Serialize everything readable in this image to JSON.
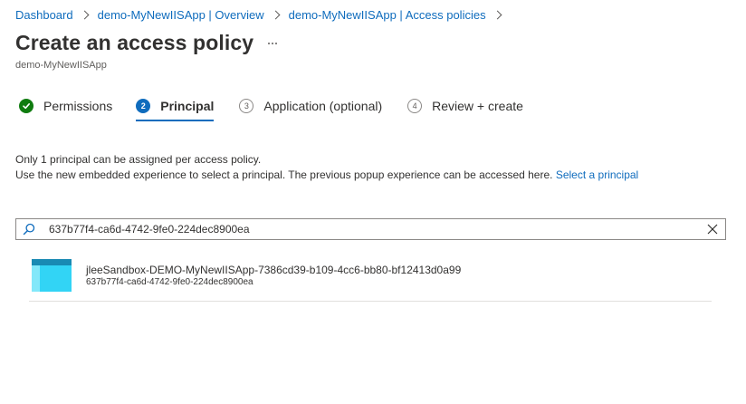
{
  "breadcrumb": {
    "items": [
      {
        "label": "Dashboard"
      },
      {
        "label": "demo-MyNewIISApp | Overview"
      },
      {
        "label": "demo-MyNewIISApp | Access policies"
      }
    ]
  },
  "header": {
    "title": "Create an access policy",
    "subtitle": "demo-MyNewIISApp",
    "more_icon": "ellipsis-icon"
  },
  "steps": [
    {
      "number": "",
      "label": "Permissions",
      "state": "completed",
      "icon": "checkmark-circle-icon"
    },
    {
      "number": "2",
      "label": "Principal",
      "state": "active"
    },
    {
      "number": "3",
      "label": "Application (optional)",
      "state": "pending"
    },
    {
      "number": "4",
      "label": "Review + create",
      "state": "pending"
    }
  ],
  "info": {
    "line1": "Only 1 principal can be assigned per access policy.",
    "line2": "Use the new embedded experience to select a principal. The previous popup experience can be accessed here.",
    "link": "Select a principal"
  },
  "search": {
    "value": "637b77f4-ca6d-4742-9fe0-224dec8900ea",
    "placeholder": "",
    "icon": "search-icon",
    "clear_icon": "close-icon"
  },
  "results": [
    {
      "name": "jleeSandbox-DEMO-MyNewIISApp-7386cd39-b109-4cc6-bb80-bf12413d0a99",
      "id": "637b77f4-ca6d-4742-9fe0-224dec8900ea",
      "icon": "app-registration-icon"
    }
  ],
  "colors": {
    "link": "#0f6cbd",
    "success": "#107c10",
    "active_step": "#0f6cbd"
  }
}
